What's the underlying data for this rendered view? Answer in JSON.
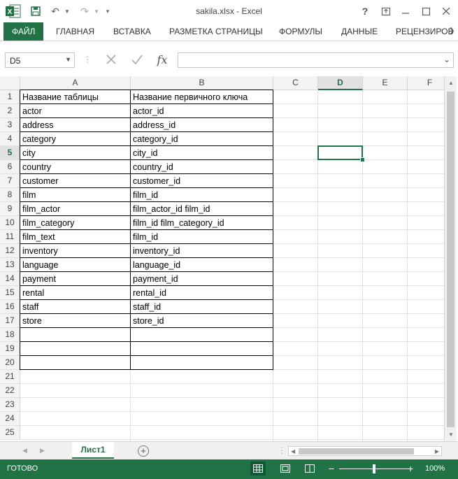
{
  "window": {
    "title": "sakila.xlsx - Excel",
    "quick_access": [
      "save-icon",
      "undo-icon",
      "redo-icon",
      "customize-icon"
    ],
    "controls": [
      "help-icon",
      "ribbon-display-icon",
      "minimize-icon",
      "maximize-icon",
      "close-icon"
    ],
    "help_glyph": "?"
  },
  "ribbon": {
    "tabs": [
      "ФАЙЛ",
      "ГЛАВНАЯ",
      "ВСТАВКА",
      "РАЗМЕТКА СТРАНИЦЫ",
      "ФОРМУЛЫ",
      "ДАННЫЕ",
      "РЕЦЕНЗИРОВ"
    ]
  },
  "formula_bar": {
    "name_box": "D5",
    "fx_label": "fx",
    "formula": ""
  },
  "grid": {
    "columns": [
      "A",
      "B",
      "C",
      "D",
      "E",
      "F"
    ],
    "selected_column": "D",
    "rows": [
      "1",
      "2",
      "3",
      "4",
      "5",
      "6",
      "7",
      "8",
      "9",
      "10",
      "11",
      "12",
      "13",
      "14",
      "15",
      "16",
      "17",
      "18",
      "19",
      "20",
      "21",
      "22",
      "23",
      "24",
      "25"
    ],
    "selected_row": "5",
    "selected_cell": "D5",
    "table": [
      [
        "Название таблицы",
        "Название первичного ключа"
      ],
      [
        "actor",
        "actor_id"
      ],
      [
        "address",
        "address_id"
      ],
      [
        "category",
        "category_id"
      ],
      [
        "city",
        "city_id"
      ],
      [
        "country",
        "country_id"
      ],
      [
        "customer",
        "customer_id"
      ],
      [
        "film",
        "film_id"
      ],
      [
        "film_actor",
        "film_actor_id  film_id"
      ],
      [
        "film_category",
        "film_id  film_category_id"
      ],
      [
        "film_text",
        "film_id"
      ],
      [
        "inventory",
        "inventory_id"
      ],
      [
        "language",
        "language_id"
      ],
      [
        "payment",
        "payment_id"
      ],
      [
        "rental",
        "rental_id"
      ],
      [
        "staff",
        "staff_id"
      ],
      [
        "store",
        "store_id"
      ],
      [
        "",
        ""
      ],
      [
        "",
        ""
      ],
      [
        "",
        ""
      ]
    ]
  },
  "sheets": {
    "tabs": [
      "Лист1"
    ],
    "add_glyph": "+"
  },
  "status_bar": {
    "status": "ГОТОВО",
    "zoom_minus": "−",
    "zoom_plus": "+",
    "zoom": "100%",
    "zoom_fraction": 0.5
  },
  "colors": {
    "accent": "#217346"
  }
}
